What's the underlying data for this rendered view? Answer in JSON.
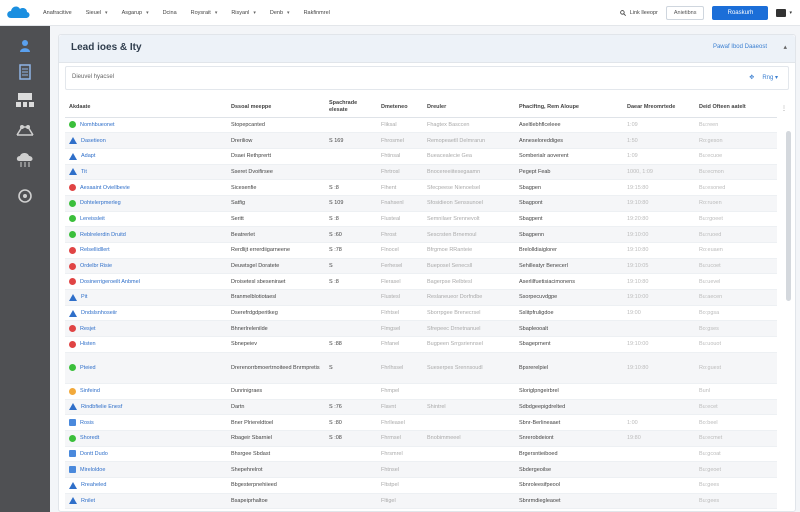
{
  "topbar": {
    "nav": [
      {
        "label": "Anafracitive",
        "dropdown": false
      },
      {
        "label": "Sieuel",
        "dropdown": true
      },
      {
        "label": "Asgarup",
        "dropdown": true
      },
      {
        "label": "Dcina",
        "dropdown": false
      },
      {
        "label": "Roysrait",
        "dropdown": true
      },
      {
        "label": "Risyanl",
        "dropdown": true
      },
      {
        "label": "Denb",
        "dropdown": true
      },
      {
        "label": "Rakfinmrel",
        "dropdown": false
      }
    ],
    "search_label": "Link lleeopr",
    "outline_button": "Anietibns",
    "primary_button": "Roaskurh",
    "colors": {
      "primary": "#1b6ed8",
      "rail": "#4f5053"
    }
  },
  "rail": {
    "icons": [
      "person-icon",
      "document-icon",
      "org-icon",
      "network-icon",
      "cloud-icon",
      "settings-icon"
    ]
  },
  "panel": {
    "title": "Lead ioes & Ity",
    "head_link": "Pawaf Ibod Daaeost",
    "filter_placeholder": "Dieuvel hyacsel",
    "filter_tools": [
      "✥",
      "Rng ▾"
    ]
  },
  "table": {
    "columns": [
      "Akdaate",
      "Dssoal meeppe",
      "Spachrade elesate",
      "Dmeteneo",
      "Dreuler",
      "Phaciftng, Rem Aloupe",
      "Daear Mreomrtede",
      "Deid Ofteen aatelt"
    ],
    "rows": [
      {
        "status": "green",
        "name": "Nomhbueonet",
        "c2": "Stopepcanted",
        "c3": "",
        "c4": "Fliksal",
        "c5": "Fhagtex  Basccen",
        "c6": "Aseltlebhflceleee",
        "c7": "1:09",
        "c8": "Bu:reen",
        "tall": false
      },
      {
        "status": "blue-tri",
        "name": "Dasetieon",
        "c2": "Dreriliow",
        "c3": "S 169",
        "c4": "Fhrosmel",
        "c5": "Remopeaetll  Delmrarun",
        "c6": "Anneseloreddiges",
        "c7": "1:50",
        "c8": "Ro:geson",
        "tall": false
      },
      {
        "status": "blue-tri",
        "name": "Adapt",
        "c2": "Dsaei Rethprertt",
        "c3": "",
        "c4": "Fhtinsal",
        "c5": "Bueacealecie  Gea",
        "c6": "Somberialr aoverent",
        "c7": "1:09",
        "c8": "Bu:ecuoe",
        "tall": false
      },
      {
        "status": "blue-tri",
        "name": "Tit",
        "c2": "Sseret Dvoifirsee",
        "c3": "",
        "c4": "Fhrtrosl",
        "c5": "Bnocereeiitesegaamn",
        "c6": "Pegept Feab",
        "c7": "1000, 1:09",
        "c8": "Bu:ecmon",
        "tall": false
      },
      {
        "status": "red",
        "name": "Aesaaint Oviellbevie",
        "c2": "Sicesenfie",
        "c3": "S :8",
        "c4": "Flhent",
        "c5": "Sfecpeese  Nienoelsel",
        "c6": "Sbagpen",
        "c7": "19:15:80",
        "c8": "Bu:esoned",
        "tall": false
      },
      {
        "status": "green",
        "name": "Dohtelerpmerleg",
        "c2": "Satfig",
        "c3": "S 109",
        "c4": "Fnahsenl",
        "c5": "Sfosidieon  Senssunoel",
        "c6": "Sbagpont",
        "c7": "19:10:80",
        "c8": "Ro:ruoen",
        "tall": false
      },
      {
        "status": "green",
        "name": "Lereissleit",
        "c2": "Seritt",
        "c3": "S :8",
        "c4": "Flusteal",
        "c5": "Semnilaer  Srennevolt",
        "c6": "Sbagpent",
        "c7": "19:20:80",
        "c8": "Bu:rgoeet",
        "tall": false
      },
      {
        "status": "green",
        "name": "Reblrelerdin Druitd",
        "c2": "Beatrerlet",
        "c3": "S :60",
        "c4": "Fhrost",
        "c5": "Sescrsten  Brnemoul",
        "c6": "Sbagpenn",
        "c7": "19:10:00",
        "c8": "Bu:ruoed",
        "tall": false
      },
      {
        "status": "red",
        "name": "Relsellidllert",
        "c2": "Rerdlijt errerdiigarneene",
        "c3": "S :78",
        "c4": "Flnocel",
        "c5": "Bfrgmoe  RRanteie",
        "c6": "Brelolldiaiglorer",
        "c7": "19:10:80",
        "c8": "Ro:euaen",
        "tall": false
      },
      {
        "status": "red",
        "name": "Ordelbr Risie",
        "c2": "Deuwtsgel Doratete",
        "c3": "S",
        "c4": "Ferhesel",
        "c5": "Bueposel  Senecsll",
        "c6": "Sehilleatyr Benecerl",
        "c7": "19:10:05",
        "c8": "Bu:ucoet",
        "tall": false
      },
      {
        "status": "red",
        "name": "Dosinerrigeroeilt Anbmel",
        "c2": "Droisetesl sbeseniraet",
        "c3": "S :8",
        "c4": "Flerasel",
        "c5": "Bagerpse  Relbtesl",
        "c6": "Aserlilfuetisiacimonens",
        "c7": "19:10:80",
        "c8": "Bu:uevel",
        "tall": false
      },
      {
        "status": "blue-tri",
        "name": "Pit",
        "c2": "Branmelblotiotaesl",
        "c3": "",
        "c4": "Flustesl",
        "c5": "Reslaneueor  Dorfndbe",
        "c6": "Ssorpecuvdgpe",
        "c7": "19:10:00",
        "c8": "Bu:aecen",
        "tall": false
      },
      {
        "status": "blue-tri",
        "name": "Dndslsnhoseiir",
        "c2": "Dserefrdgdperitkeg",
        "c3": "",
        "c4": "Flrhtsel",
        "c5": "Sborrpgee  Brenecrsel",
        "c6": "Sslitpfruligdoe",
        "c7": "19:00",
        "c8": "Bo:pgsa",
        "tall": false
      },
      {
        "status": "red",
        "name": "Resjet",
        "c2": "Bhnerlrelenilde",
        "c3": "",
        "c4": "Flmgsel",
        "c5": "Sfrepeec  Drnetnanuel",
        "c6": "Sbapleooalt",
        "c7": "",
        "c8": "Bo:gses",
        "tall": false
      },
      {
        "status": "red",
        "name": "Histen",
        "c2": "Sbnepeiev",
        "c3": "S :88",
        "c4": "Fhfanel",
        "c5": "Bugpeen  Srrgsriennsel",
        "c6": "Sbageprnent",
        "c7": "19:10:00",
        "c8": "Bu:uouot",
        "tall": false
      },
      {
        "status": "green",
        "name": "Pteied",
        "c2": "Drerenorrbmoertrnoiteed Bnrmpretis",
        "c3": "S",
        "c4": "Fhrlhssel",
        "c5": "Sueserpes  Srennsoudl",
        "c6": "Bpsrerelpiel",
        "c7": "19:10:80",
        "c8": "Ro:guest",
        "tall": true
      },
      {
        "status": "orange",
        "name": "Sinfeind",
        "c2": "Dunrinigraes",
        "c3": "",
        "c4": "Fhmpel",
        "c5": "",
        "c6": "Sloriglpngeirbrel",
        "c7": "",
        "c8": "Bunl",
        "tall": false
      },
      {
        "status": "blue-tri",
        "name": "Rindbfielie Enesf",
        "c2": "Dartn",
        "c3": "S :76",
        "c4": "Flavnt",
        "c5": "Shintrel",
        "c6": "Sdbdgeepigdrelted",
        "c7": "",
        "c8": "Bu:ecet",
        "tall": false
      },
      {
        "status": "blue-sq",
        "name": "Rosis",
        "c2": "Bner Plriereldtoel",
        "c3": "S :80",
        "c4": "Fhrlleasel",
        "c5": "",
        "c6": "Sbnr-Berlineaaet",
        "c7": "1:00",
        "c8": "Bo:beel",
        "tall": false
      },
      {
        "status": "green",
        "name": "Shoredt",
        "c2": "Rbageir Sbarniel",
        "c3": "S :08",
        "c4": "Fhrmsel",
        "c5": "Bnobimmeeel",
        "c6": "Snrerobdeiont",
        "c7": "19:80",
        "c8": "Bu:ecmet",
        "tall": false
      },
      {
        "status": "blue-sq",
        "name": "Dontt Dudo",
        "c2": "Bhsrgee Sbdast",
        "c3": "",
        "c4": "Fhrsmrel",
        "c5": "",
        "c6": "Brgersntieiboed",
        "c7": "",
        "c8": "Bu:gcoat",
        "tall": false
      },
      {
        "status": "blue-sq",
        "name": "Mireloldoe",
        "c2": "Shepehrelrot",
        "c3": "",
        "c4": "Fhtnsel",
        "c5": "",
        "c6": "Sbdergeoilse",
        "c7": "",
        "c8": "Bu:geoet",
        "tall": false
      },
      {
        "status": "blue-tri",
        "name": "Rreaheled",
        "c2": "Bbgesterpnehiieed",
        "c3": "",
        "c4": "Fltstpel",
        "c5": "",
        "c6": "Sbnroleesifpeool",
        "c7": "",
        "c8": "Bu:gees",
        "tall": false
      },
      {
        "status": "blue-tri",
        "name": "Rnilet",
        "c2": "Bsapeiprhaltoe",
        "c3": "",
        "c4": "Fltigel",
        "c5": "",
        "c6": "Sbnrmdiegleaoet",
        "c7": "",
        "c8": "Bu:gees",
        "tall": false
      }
    ]
  }
}
